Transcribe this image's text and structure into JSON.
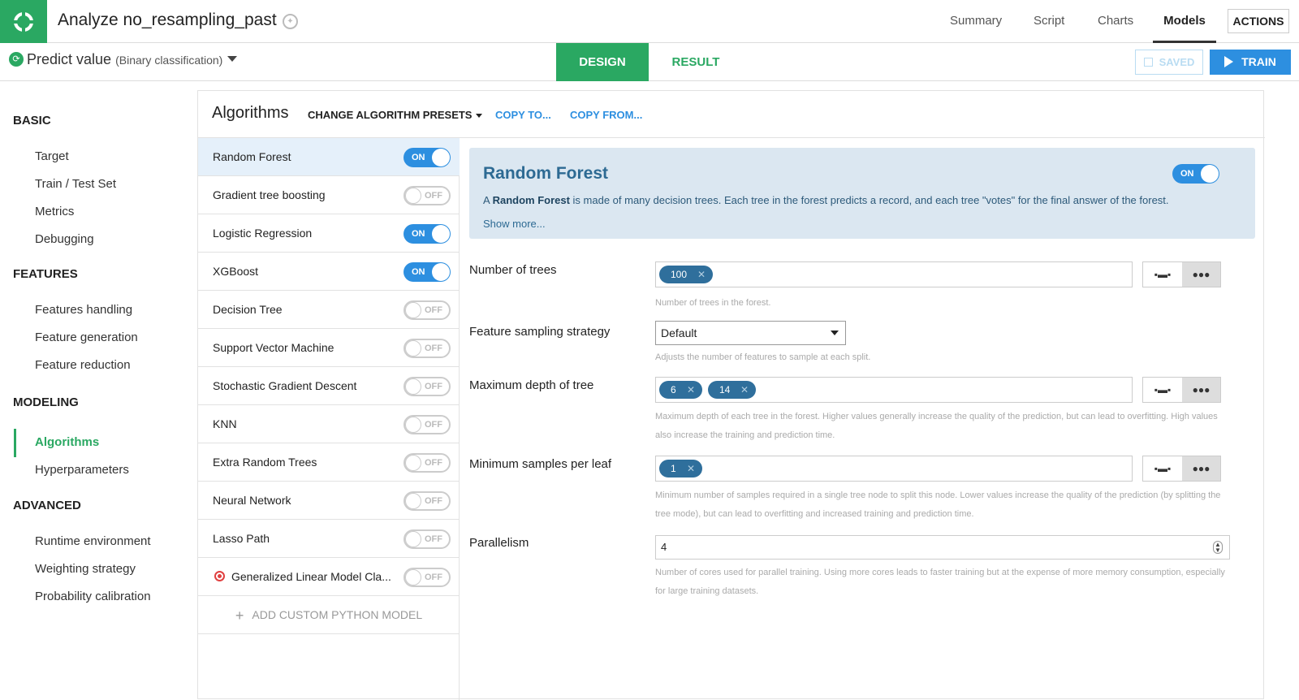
{
  "header": {
    "title": "Analyze no_resampling_past",
    "nav": [
      "Summary",
      "Script",
      "Charts",
      "Models"
    ],
    "active_nav": "Models",
    "actions_label": "ACTIONS"
  },
  "subbar": {
    "predict_label": "Predict value",
    "predict_sub": "(Binary classification)",
    "tab_design": "DESIGN",
    "tab_result": "RESULT",
    "saved_label": "SAVED",
    "train_label": "TRAIN"
  },
  "sidebar": {
    "sections": [
      {
        "title": "BASIC",
        "items": [
          "Target",
          "Train / Test Set",
          "Metrics",
          "Debugging"
        ]
      },
      {
        "title": "FEATURES",
        "items": [
          "Features handling",
          "Feature generation",
          "Feature reduction"
        ]
      },
      {
        "title": "MODELING",
        "items": [
          "Algorithms",
          "Hyperparameters"
        ]
      },
      {
        "title": "ADVANCED",
        "items": [
          "Runtime environment",
          "Weighting strategy",
          "Probability calibration"
        ]
      }
    ],
    "active_item": "Algorithms"
  },
  "panel": {
    "title": "Algorithms",
    "change_presets": "CHANGE ALGORITHM PRESETS",
    "copy_to": "COPY TO...",
    "copy_from": "COPY FROM...",
    "algorithms": [
      {
        "name": "Random Forest",
        "state": "ON"
      },
      {
        "name": "Gradient tree boosting",
        "state": "OFF"
      },
      {
        "name": "Logistic Regression",
        "state": "ON"
      },
      {
        "name": "XGBoost",
        "state": "ON"
      },
      {
        "name": "Decision Tree",
        "state": "OFF"
      },
      {
        "name": "Support Vector Machine",
        "state": "OFF"
      },
      {
        "name": "Stochastic Gradient Descent",
        "state": "OFF"
      },
      {
        "name": "KNN",
        "state": "OFF"
      },
      {
        "name": "Extra Random Trees",
        "state": "OFF"
      },
      {
        "name": "Neural Network",
        "state": "OFF"
      },
      {
        "name": "Lasso Path",
        "state": "OFF"
      },
      {
        "name": "Generalized Linear Model Cla...",
        "state": "OFF"
      }
    ],
    "add_custom": "ADD CUSTOM PYTHON MODEL"
  },
  "detail": {
    "title": "Random Forest",
    "state": "ON",
    "desc_prefix": "A ",
    "desc_bold": "Random Forest",
    "desc_rest": " is made of many decision trees. Each tree in the forest predicts a record, and each tree \"votes\" for the final answer of the forest.",
    "show_more": "Show more...",
    "params": {
      "n_trees": {
        "label": "Number of trees",
        "chips": [
          "100"
        ],
        "help": "Number of trees in the forest."
      },
      "sampling": {
        "label": "Feature sampling strategy",
        "value": "Default",
        "help": "Adjusts the number of features to sample at each split."
      },
      "max_depth": {
        "label": "Maximum depth of tree",
        "chips": [
          "6",
          "14"
        ],
        "help": "Maximum depth of each tree in the forest. Higher values generally increase the quality of the prediction, but can lead to overfitting. High values also increase the training and prediction time."
      },
      "min_samples": {
        "label": "Minimum samples per leaf",
        "chips": [
          "1"
        ],
        "help": "Minimum number of samples required in a single tree node to split this node. Lower values increase the quality of the prediction (by splitting the tree mode), but can lead to overfitting and increased training and prediction time."
      },
      "parallelism": {
        "label": "Parallelism",
        "value": "4",
        "help": "Number of cores used for parallel training. Using more cores leads to faster training but at the expense of more memory consumption, especially for large training datasets."
      }
    }
  }
}
